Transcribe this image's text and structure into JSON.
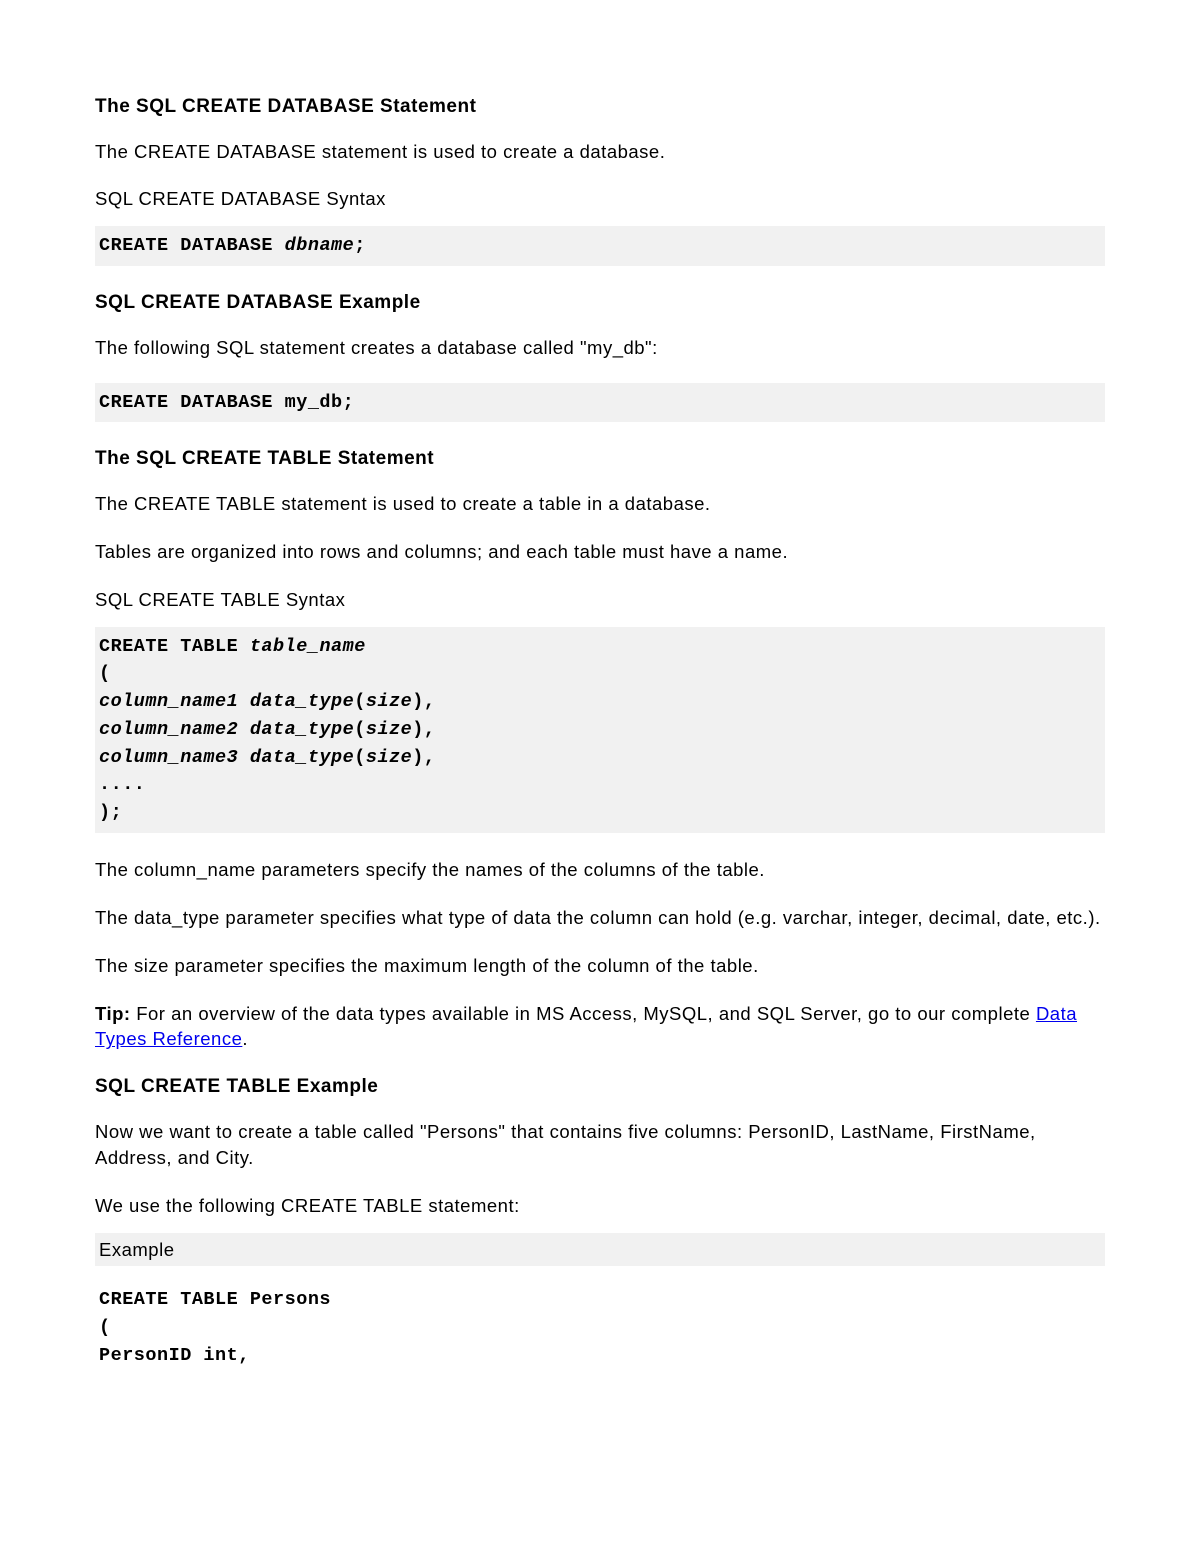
{
  "section1": {
    "heading": "The SQL CREATE DATABASE Statement",
    "intro": "The CREATE DATABASE statement is used to create a database.",
    "syntax_label": "SQL CREATE DATABASE Syntax",
    "syntax_code_kw": "CREATE DATABASE ",
    "syntax_code_var": "dbname",
    "syntax_code_end": ";"
  },
  "section2": {
    "heading": "SQL CREATE DATABASE Example",
    "intro": "The following SQL statement creates a database called \"my_db\":",
    "code": "CREATE DATABASE my_db;"
  },
  "section3": {
    "heading": "The SQL CREATE TABLE Statement",
    "p1": "The CREATE TABLE statement is used to create a table in a database.",
    "p2": "Tables are organized into rows and columns; and each table must have a name.",
    "syntax_label": "SQL CREATE TABLE Syntax",
    "code_kw1": "CREATE TABLE ",
    "code_var1": "table_name",
    "code_line2": "(",
    "code_var_l3": "column_name1 data_type",
    "code_plain_l3a": "(",
    "code_var_l3b": "size",
    "code_plain_l3c": "),",
    "code_var_l4": "column_name2 data_type",
    "code_var_l5": "column_name3 data_type",
    "code_line6": "....",
    "code_line7": ");",
    "p3": "The column_name parameters specify the names of the columns of the table.",
    "p4": "The data_type parameter specifies what type of data the column can hold (e.g. varchar, integer, decimal, date, etc.).",
    "p5": "The size parameter specifies the maximum length of the column of the table.",
    "tip_label": "Tip:",
    "tip_text1": " For an overview of the data types available in MS Access, MySQL, and SQL Server, go to our complete ",
    "tip_link": "Data Types Reference",
    "tip_text2": "."
  },
  "section4": {
    "heading": "SQL CREATE TABLE Example",
    "p1": "Now we want to create a table called \"Persons\" that contains five columns: PersonID, LastName, FirstName, Address, and City.",
    "p2": "We use the following CREATE TABLE statement:",
    "example_label": "Example",
    "code_l1": "CREATE TABLE Persons",
    "code_l2": "(",
    "code_l3": "PersonID int,"
  }
}
